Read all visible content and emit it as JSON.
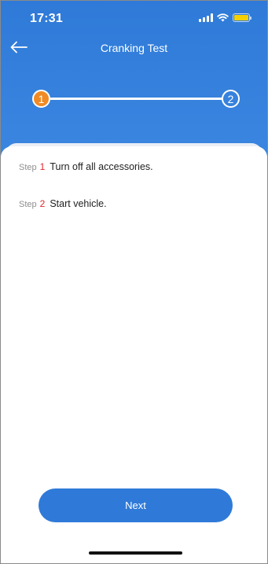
{
  "status_bar": {
    "time": "17:31",
    "signal_icon": "cellular-signal-icon",
    "wifi_icon": "wifi-icon",
    "battery_icon": "battery-icon",
    "battery_color": "#f5d000"
  },
  "nav": {
    "back_icon": "arrow-left-icon",
    "title": "Cranking Test"
  },
  "stepper": {
    "current": 1,
    "steps": [
      "1",
      "2"
    ],
    "active_color": "#f08a24"
  },
  "instructions": [
    {
      "word": "Step",
      "number": "1",
      "text": "Turn off all accessories."
    },
    {
      "word": "Step",
      "number": "2",
      "text": "Start vehicle."
    }
  ],
  "actions": {
    "next_label": "Next"
  },
  "colors": {
    "primary": "#2f7ad8",
    "step_number": "#e5252a"
  }
}
